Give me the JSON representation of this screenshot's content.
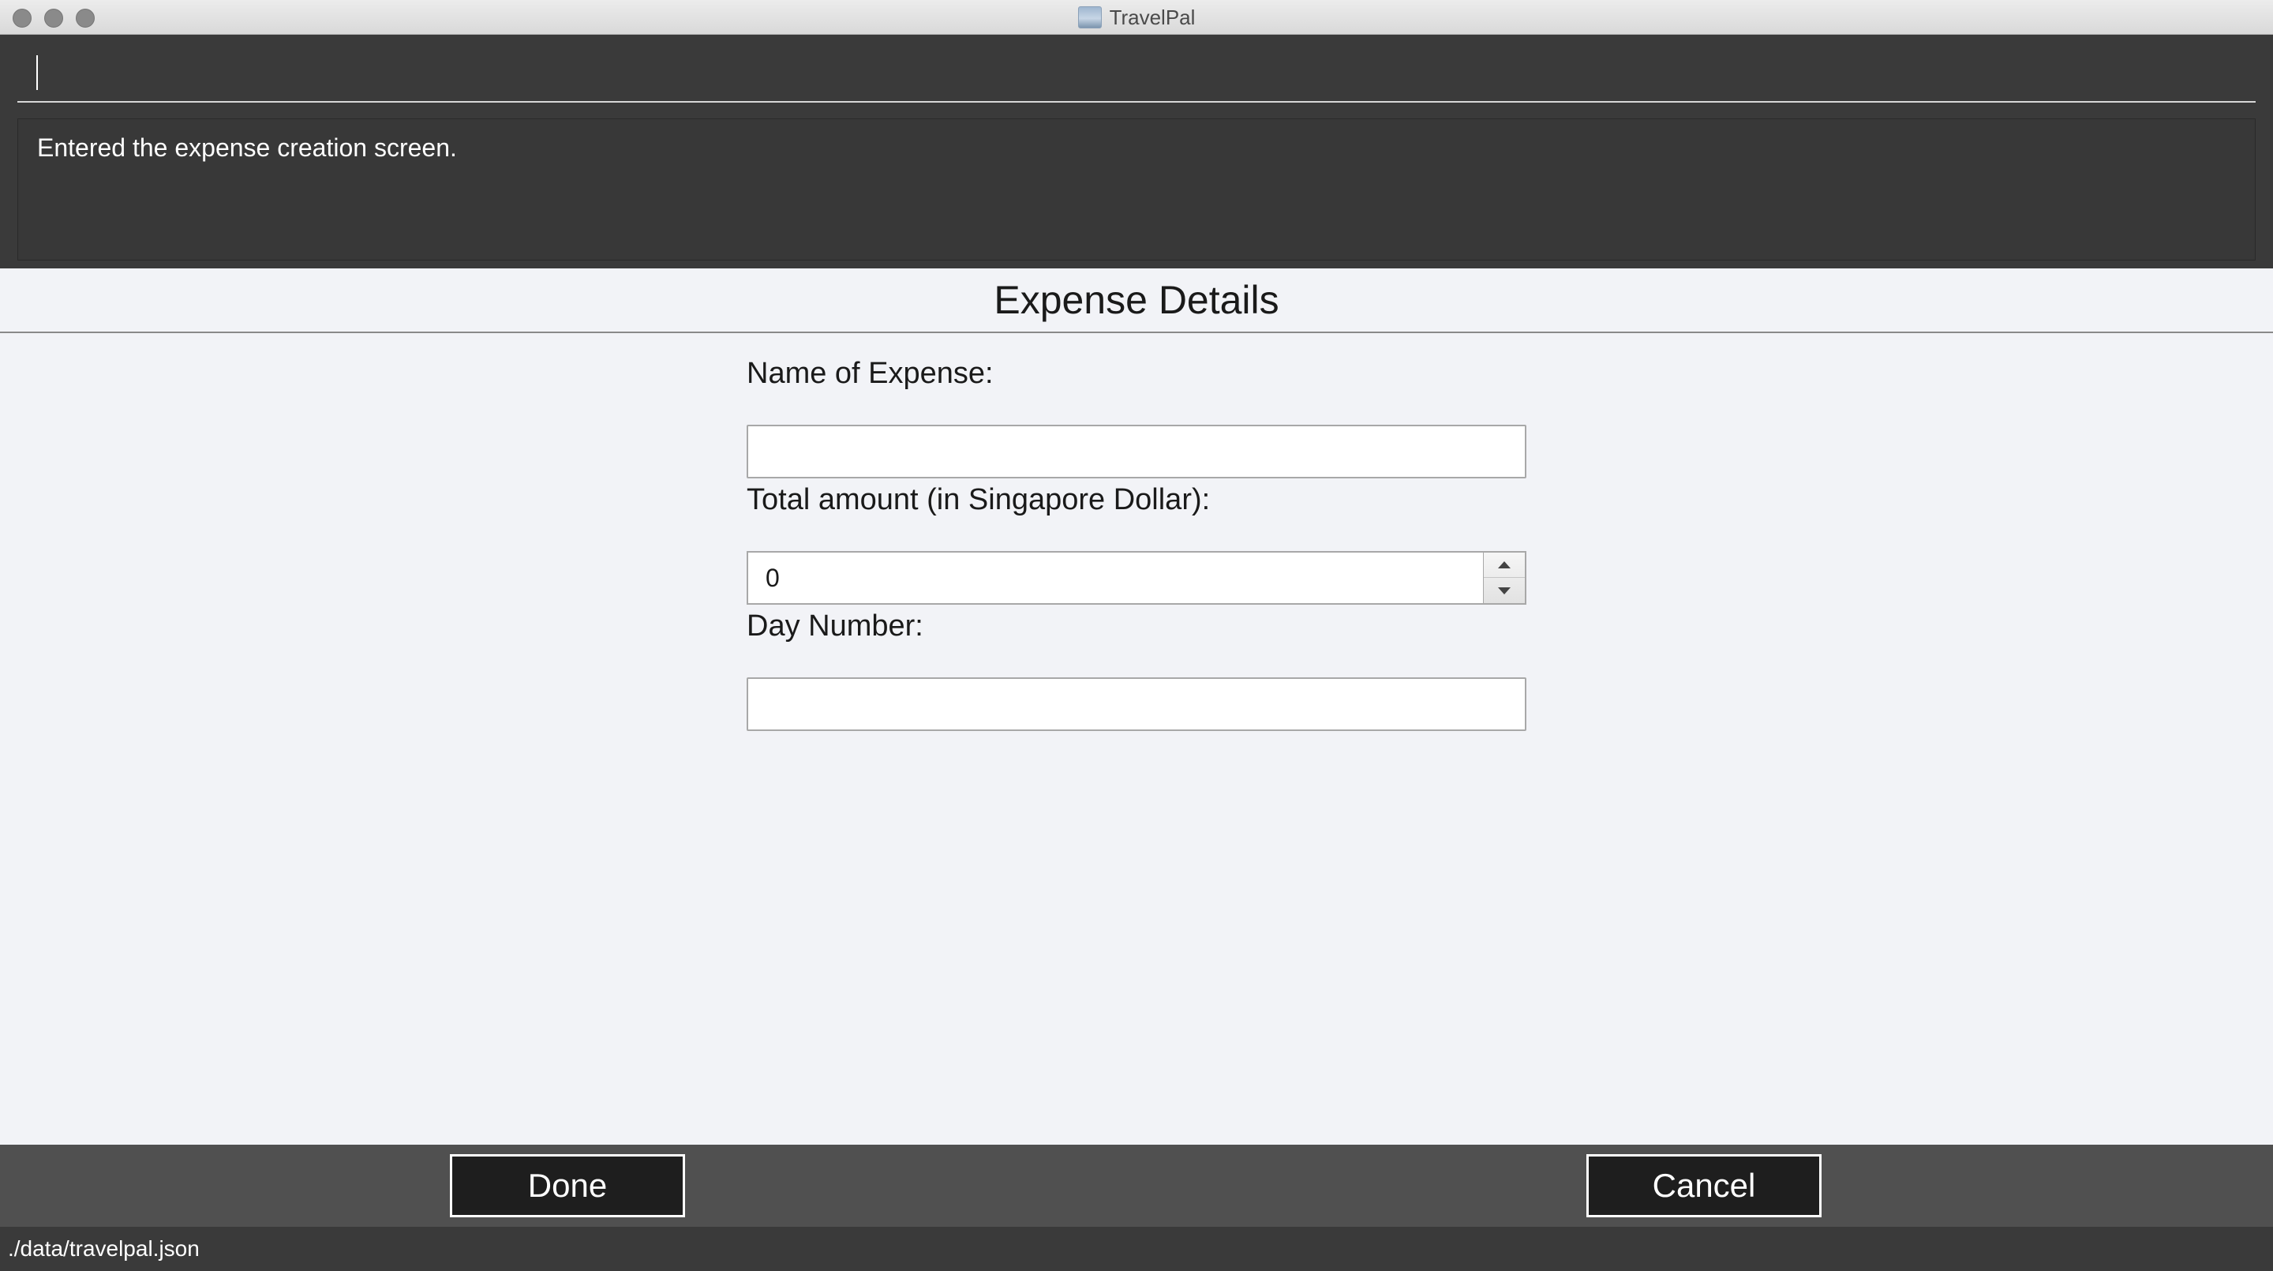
{
  "window": {
    "title": "TravelPal"
  },
  "command": {
    "value": "",
    "placeholder": ""
  },
  "result": {
    "message": "Entered the expense creation screen."
  },
  "form": {
    "section_title": "Expense Details",
    "name": {
      "label": "Name of Expense:",
      "value": ""
    },
    "amount": {
      "label": "Total amount (in Singapore Dollar):",
      "value": "0"
    },
    "day": {
      "label": "Day Number:",
      "value": ""
    }
  },
  "buttons": {
    "done_label": "Done",
    "cancel_label": "Cancel"
  },
  "status": {
    "file_path": "./data/travelpal.json"
  },
  "icons": {
    "close": "traffic-light-close",
    "minimize": "traffic-light-minimize",
    "maximize": "traffic-light-maximize",
    "app": "travelpal-app-icon",
    "spin_up": "chevron-up",
    "spin_down": "chevron-down"
  }
}
